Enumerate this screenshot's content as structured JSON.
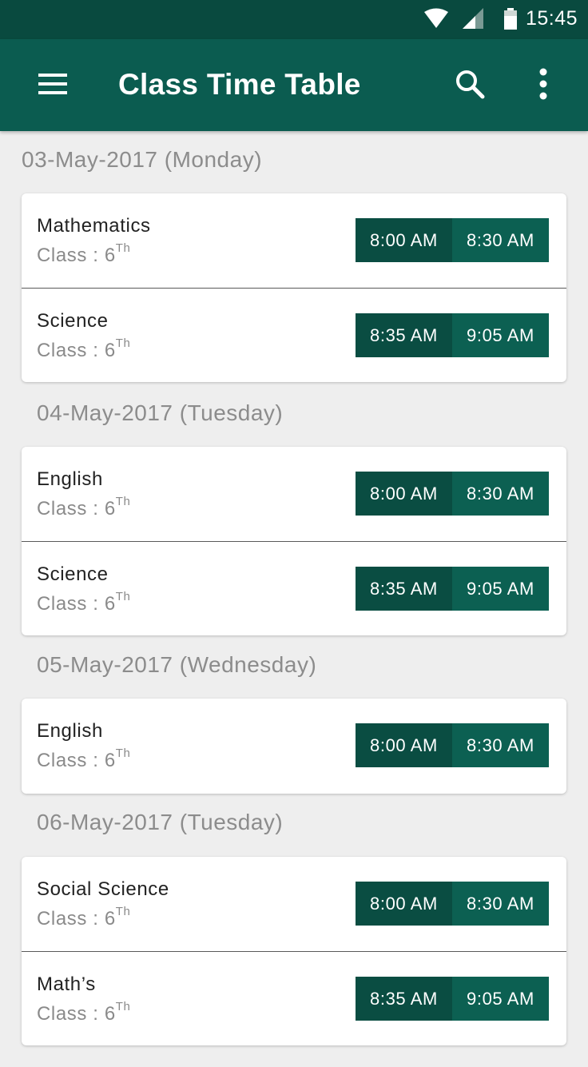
{
  "status_bar": {
    "time": "15:45"
  },
  "app_bar": {
    "title": "Class Time Table"
  },
  "class_prefix": "Class : 6",
  "class_suffix": "Th",
  "days": [
    {
      "date": "03-May-2017 (Monday)",
      "classes": [
        {
          "subject": "Mathematics",
          "start": "8:00 AM",
          "end": "8:30 AM"
        },
        {
          "subject": "Science",
          "start": "8:35 AM",
          "end": "9:05 AM"
        }
      ]
    },
    {
      "date": "04-May-2017 (Tuesday)",
      "classes": [
        {
          "subject": "English",
          "start": "8:00 AM",
          "end": "8:30 AM"
        },
        {
          "subject": "Science",
          "start": "8:35 AM",
          "end": "9:05 AM"
        }
      ]
    },
    {
      "date": "05-May-2017 (Wednesday)",
      "classes": [
        {
          "subject": "English",
          "start": "8:00 AM",
          "end": "8:30 AM"
        }
      ]
    },
    {
      "date": "06-May-2017 (Tuesday)",
      "classes": [
        {
          "subject": "Social Science",
          "start": "8:00 AM",
          "end": "8:30 AM"
        },
        {
          "subject": "Math’s",
          "start": "8:35 AM",
          "end": "9:05 AM"
        }
      ]
    }
  ],
  "colors": {
    "primary": "#0b5c50",
    "primary_dark": "#094a3f",
    "time_start": "#0a4d42",
    "time_end": "#0c6052"
  },
  "icons": [
    "wifi-icon",
    "signal-icon",
    "battery-icon",
    "menu-icon",
    "search-icon",
    "more-vert-icon"
  ]
}
